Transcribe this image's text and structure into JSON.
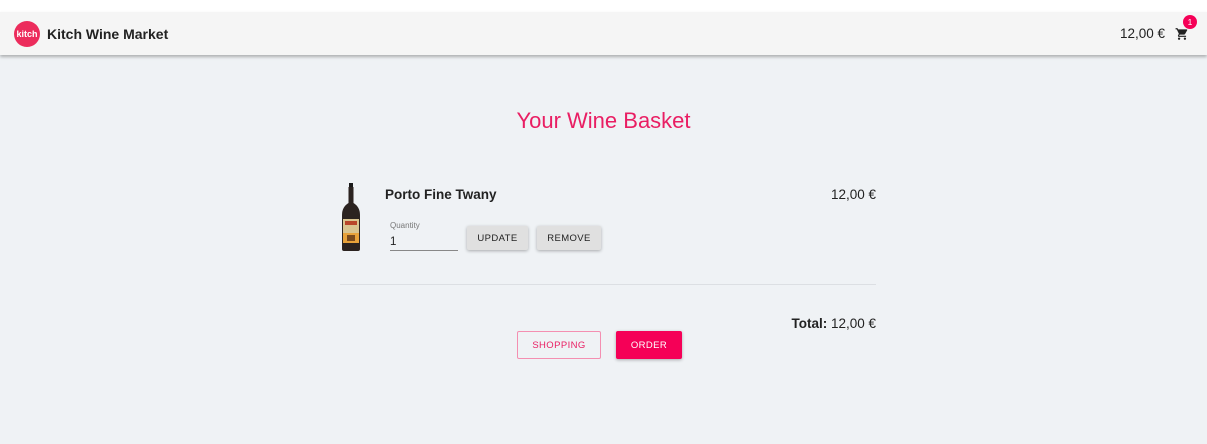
{
  "header": {
    "logo_text": "kitch",
    "brand": "Kitch Wine Market",
    "cart_total": "12,00 €",
    "cart_count": "1"
  },
  "page": {
    "title": "Your Wine Basket"
  },
  "basket": {
    "items": [
      {
        "name": "Porto Fine Twany",
        "price": "12,00 €",
        "quantity_label": "Quantity",
        "quantity": "1",
        "update_label": "UPDATE",
        "remove_label": "REMOVE"
      }
    ],
    "total_label": "Total:",
    "total_value": " 12,00 €"
  },
  "actions": {
    "shopping_label": "SHOPPING",
    "order_label": "ORDER"
  },
  "colors": {
    "accent": "#e91e63",
    "primary": "#f50057",
    "background": "#eff2f5"
  },
  "icons": {
    "cart": "shopping-cart-icon",
    "bottle": "wine-bottle-image"
  }
}
